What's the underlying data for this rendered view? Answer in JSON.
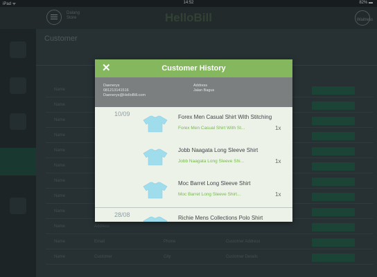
{
  "status_bar": {
    "device": "iPad ᯤ",
    "time": "14:52",
    "battery": "82% ▬"
  },
  "header": {
    "brand": "HelloBill",
    "store_line1": "Dalang",
    "store_line2": "Store",
    "user_label": "Waitress"
  },
  "page": {
    "title": "Customer"
  },
  "background_rows": [
    {
      "a": "Name",
      "b": "",
      "c": "",
      "d": ""
    },
    {
      "a": "Name",
      "b": "",
      "c": "",
      "d": ""
    },
    {
      "a": "Name",
      "b": "",
      "c": "",
      "d": ""
    },
    {
      "a": "Name",
      "b": "",
      "c": "",
      "d": ""
    },
    {
      "a": "Name",
      "b": "",
      "c": "",
      "d": ""
    },
    {
      "a": "Name",
      "b": "",
      "c": "",
      "d": ""
    },
    {
      "a": "Name",
      "b": "",
      "c": "",
      "d": ""
    },
    {
      "a": "Name",
      "b": "",
      "c": "",
      "d": ""
    },
    {
      "a": "Name",
      "b": "",
      "c": "",
      "d": ""
    },
    {
      "a": "Name",
      "b": "Address",
      "c": "",
      "d": ""
    },
    {
      "a": "Name",
      "b": "Email",
      "c": "Phone",
      "d": "Customer Address"
    },
    {
      "a": "Name",
      "b": "Customer",
      "c": "City",
      "d": "Customer Details"
    }
  ],
  "modal": {
    "title": "Customer History",
    "close_icon": "✕",
    "customer": {
      "name": "Daenerys",
      "phone": "081213141516",
      "email": "Daenerys@HelloBill.com",
      "address_label": "Address",
      "address_value": "Jalan Bagus"
    },
    "entries": [
      {
        "date": "10/09",
        "name": "Forex Men Casual Shirt With Stitching",
        "sub": "Forex Men Casual Shirt With St...",
        "qty": "1x",
        "icon": "t-shirt-icon"
      },
      {
        "date": "",
        "name": "Jobb Naagata Long Sleeve Shirt",
        "sub": "Jobb Naagata Long Sleeve Shi...",
        "qty": "1x",
        "icon": "t-shirt-icon"
      },
      {
        "date": "",
        "name": "Moc Barret Long Sleeve Shirt",
        "sub": "Moc Barret Long Sleeve Shirt...",
        "qty": "1x",
        "icon": "t-shirt-icon"
      },
      {
        "date": "28/08",
        "name": "Richie Mens Collections Polo Shirt",
        "sub": "",
        "qty": "",
        "icon": "t-shirt-icon"
      }
    ]
  },
  "colors": {
    "accent_green": "#85b75e",
    "link_green": "#74b84b",
    "shirt_blue": "#9fdcec"
  }
}
